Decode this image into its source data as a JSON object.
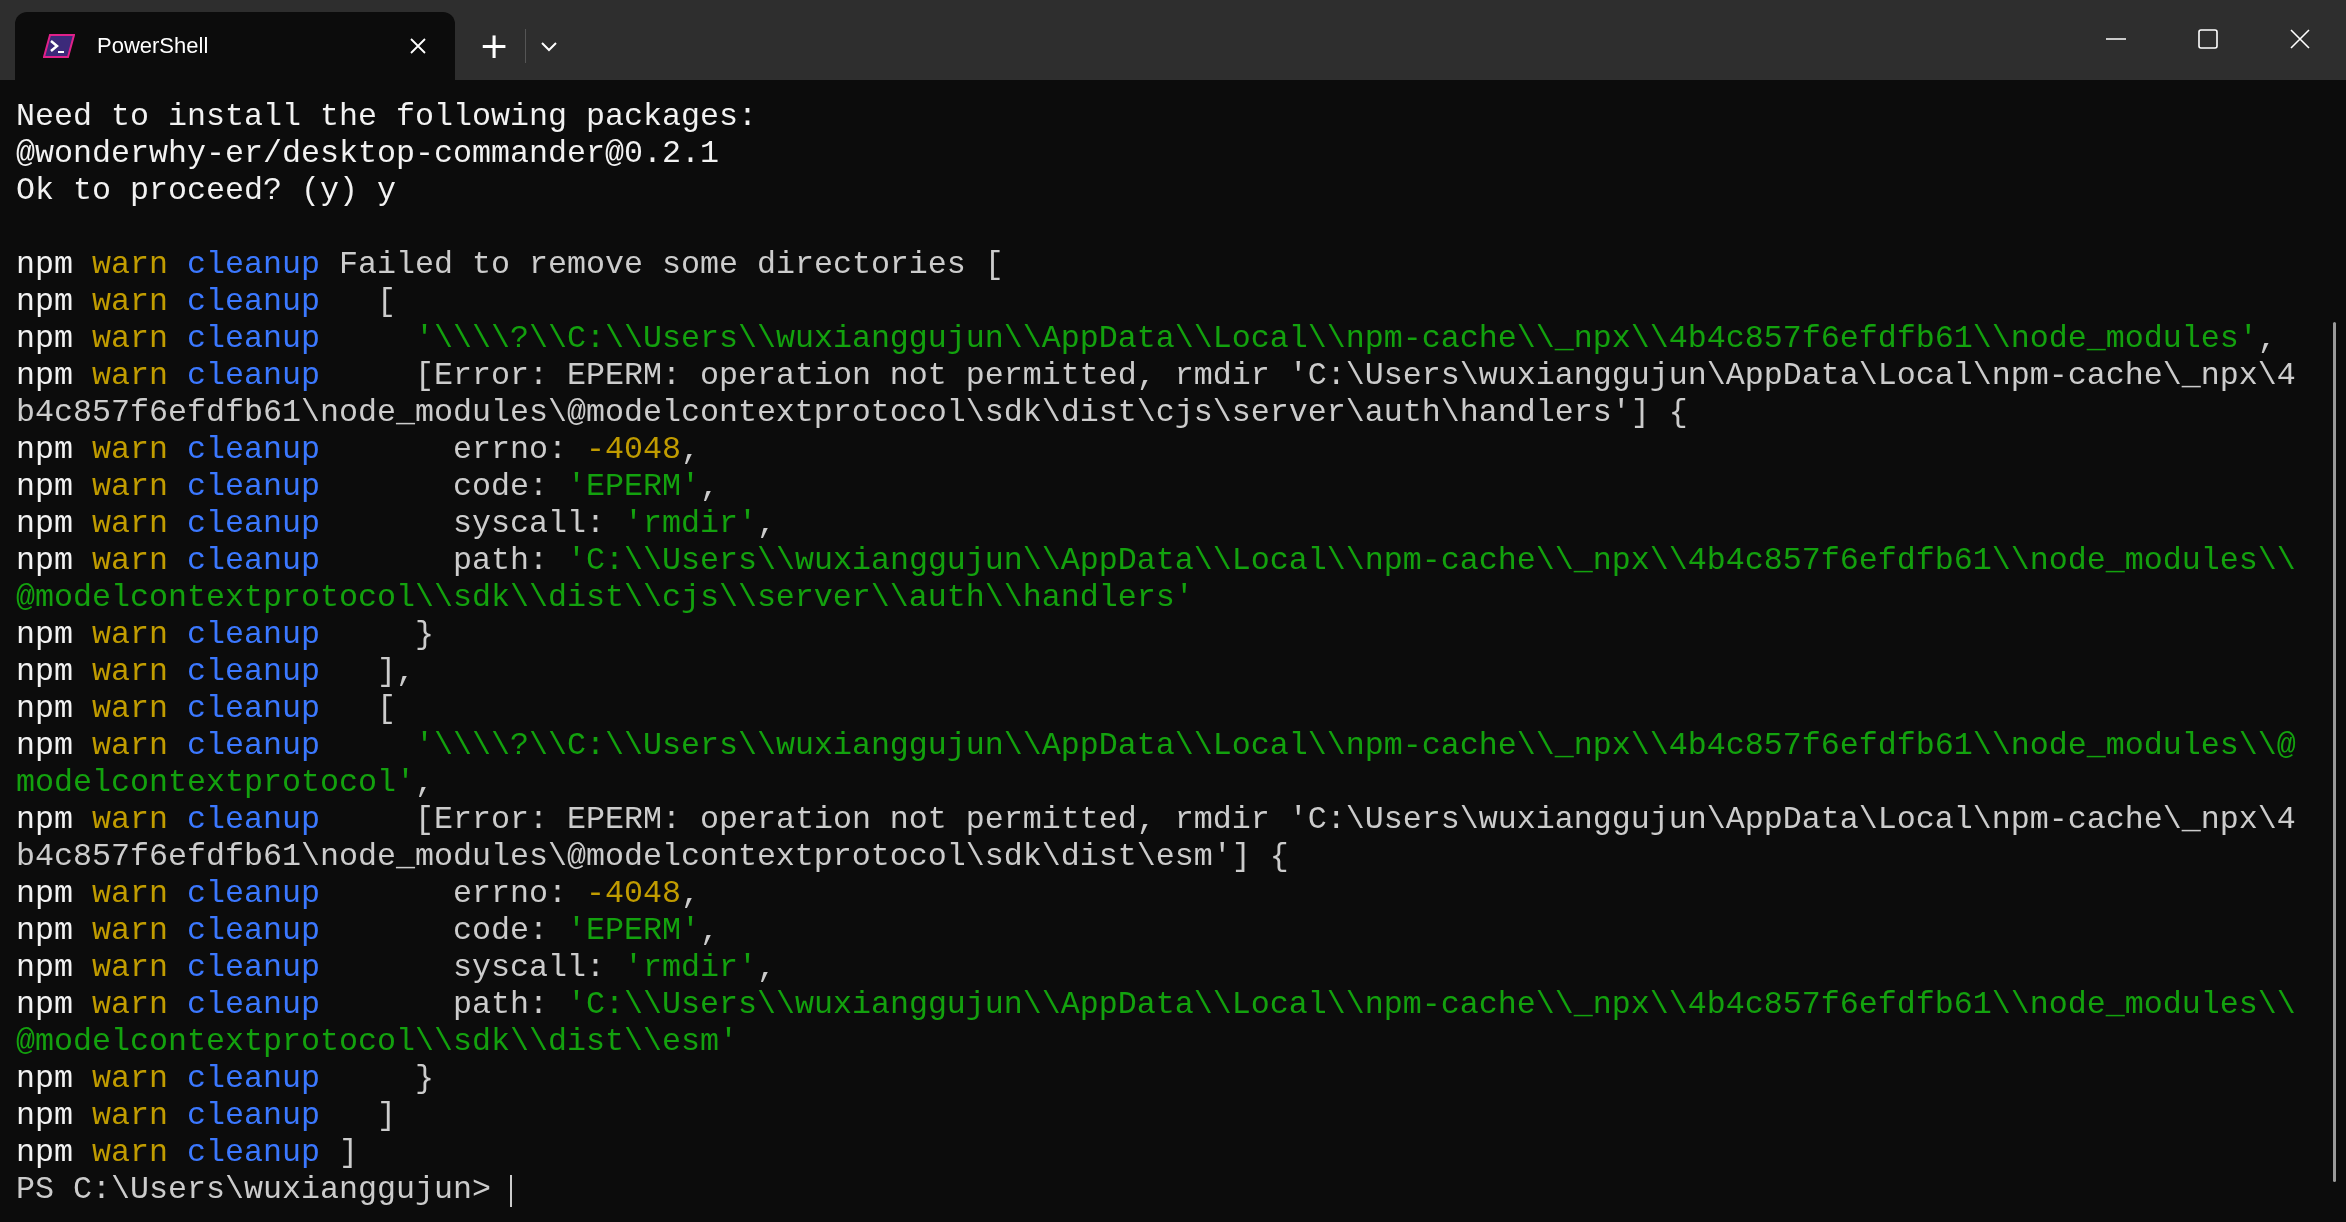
{
  "window": {
    "tabs": [
      {
        "title": "PowerShell",
        "selected": true
      }
    ],
    "new_tab": "+"
  },
  "terminal": {
    "blocks": [
      {
        "lines": [
          [
            {
              "kind": "bright",
              "text": "Need to install the following packages:"
            }
          ],
          [
            {
              "kind": "bright",
              "text": "@wonderwhy-er/desktop-commander@0.2.1"
            }
          ],
          [
            {
              "kind": "bright",
              "text": "Ok to proceed? (y) y"
            }
          ]
        ]
      },
      {
        "lines": [
          [
            {
              "kind": "bright",
              "text": "npm"
            },
            {
              "kind": "warn",
              "text": " warn"
            },
            {
              "kind": "cleanup",
              "text": " cleanup"
            },
            {
              "kind": "plain",
              "text": " Failed to remove some directories ["
            }
          ],
          [
            {
              "kind": "bright",
              "text": "npm"
            },
            {
              "kind": "warn",
              "text": " warn"
            },
            {
              "kind": "cleanup",
              "text": " cleanup"
            },
            {
              "kind": "plain",
              "text": "   ["
            }
          ],
          [
            {
              "kind": "bright",
              "text": "npm"
            },
            {
              "kind": "warn",
              "text": " warn"
            },
            {
              "kind": "cleanup",
              "text": " cleanup"
            },
            {
              "kind": "string",
              "text": "     '\\\\\\\\?\\\\C:\\\\Users\\\\wuxianggujun\\\\AppData\\\\Local\\\\npm-cache\\\\_npx\\\\4b4c857f6efdfb61\\\\node_modules'"
            },
            {
              "kind": "plain",
              "text": ","
            }
          ],
          [
            {
              "kind": "bright",
              "text": "npm"
            },
            {
              "kind": "warn",
              "text": " warn"
            },
            {
              "kind": "cleanup",
              "text": " cleanup"
            },
            {
              "kind": "plain",
              "text": "     [Error: EPERM: operation not permitted, rmdir 'C:\\Users\\wuxianggujun\\AppData\\Local\\npm-cache\\_npx\\4"
            }
          ],
          [
            {
              "kind": "plain",
              "text": "b4c857f6efdfb61\\node_modules\\@modelcontextprotocol\\sdk\\dist\\cjs\\server\\auth\\handlers'] {"
            }
          ],
          [
            {
              "kind": "bright",
              "text": "npm"
            },
            {
              "kind": "warn",
              "text": " warn"
            },
            {
              "kind": "cleanup",
              "text": " cleanup"
            },
            {
              "kind": "plain",
              "text": "       errno: "
            },
            {
              "kind": "number",
              "text": "-4048"
            },
            {
              "kind": "plain",
              "text": ","
            }
          ],
          [
            {
              "kind": "bright",
              "text": "npm"
            },
            {
              "kind": "warn",
              "text": " warn"
            },
            {
              "kind": "cleanup",
              "text": " cleanup"
            },
            {
              "kind": "plain",
              "text": "       code: "
            },
            {
              "kind": "string",
              "text": "'EPERM'"
            },
            {
              "kind": "plain",
              "text": ","
            }
          ],
          [
            {
              "kind": "bright",
              "text": "npm"
            },
            {
              "kind": "warn",
              "text": " warn"
            },
            {
              "kind": "cleanup",
              "text": " cleanup"
            },
            {
              "kind": "plain",
              "text": "       syscall: "
            },
            {
              "kind": "string",
              "text": "'rmdir'"
            },
            {
              "kind": "plain",
              "text": ","
            }
          ],
          [
            {
              "kind": "bright",
              "text": "npm"
            },
            {
              "kind": "warn",
              "text": " warn"
            },
            {
              "kind": "cleanup",
              "text": " cleanup"
            },
            {
              "kind": "plain",
              "text": "       path: "
            },
            {
              "kind": "string",
              "text": "'C:\\\\Users\\\\wuxianggujun\\\\AppData\\\\Local\\\\npm-cache\\\\_npx\\\\4b4c857f6efdfb61\\\\node_modules\\\\"
            }
          ],
          [
            {
              "kind": "string",
              "text": "@modelcontextprotocol\\\\sdk\\\\dist\\\\cjs\\\\server\\\\auth\\\\handlers'"
            }
          ],
          [
            {
              "kind": "bright",
              "text": "npm"
            },
            {
              "kind": "warn",
              "text": " warn"
            },
            {
              "kind": "cleanup",
              "text": " cleanup"
            },
            {
              "kind": "plain",
              "text": "     }"
            }
          ],
          [
            {
              "kind": "bright",
              "text": "npm"
            },
            {
              "kind": "warn",
              "text": " warn"
            },
            {
              "kind": "cleanup",
              "text": " cleanup"
            },
            {
              "kind": "plain",
              "text": "   ],"
            }
          ],
          [
            {
              "kind": "bright",
              "text": "npm"
            },
            {
              "kind": "warn",
              "text": " warn"
            },
            {
              "kind": "cleanup",
              "text": " cleanup"
            },
            {
              "kind": "plain",
              "text": "   ["
            }
          ],
          [
            {
              "kind": "bright",
              "text": "npm"
            },
            {
              "kind": "warn",
              "text": " warn"
            },
            {
              "kind": "cleanup",
              "text": " cleanup"
            },
            {
              "kind": "string",
              "text": "     '\\\\\\\\?\\\\C:\\\\Users\\\\wuxianggujun\\\\AppData\\\\Local\\\\npm-cache\\\\_npx\\\\4b4c857f6efdfb61\\\\node_modules\\\\@"
            }
          ],
          [
            {
              "kind": "string",
              "text": "modelcontextprotocol'"
            },
            {
              "kind": "plain",
              "text": ","
            }
          ],
          [
            {
              "kind": "bright",
              "text": "npm"
            },
            {
              "kind": "warn",
              "text": " warn"
            },
            {
              "kind": "cleanup",
              "text": " cleanup"
            },
            {
              "kind": "plain",
              "text": "     [Error: EPERM: operation not permitted, rmdir 'C:\\Users\\wuxianggujun\\AppData\\Local\\npm-cache\\_npx\\4"
            }
          ],
          [
            {
              "kind": "plain",
              "text": "b4c857f6efdfb61\\node_modules\\@modelcontextprotocol\\sdk\\dist\\esm'] {"
            }
          ],
          [
            {
              "kind": "bright",
              "text": "npm"
            },
            {
              "kind": "warn",
              "text": " warn"
            },
            {
              "kind": "cleanup",
              "text": " cleanup"
            },
            {
              "kind": "plain",
              "text": "       errno: "
            },
            {
              "kind": "number",
              "text": "-4048"
            },
            {
              "kind": "plain",
              "text": ","
            }
          ],
          [
            {
              "kind": "bright",
              "text": "npm"
            },
            {
              "kind": "warn",
              "text": " warn"
            },
            {
              "kind": "cleanup",
              "text": " cleanup"
            },
            {
              "kind": "plain",
              "text": "       code: "
            },
            {
              "kind": "string",
              "text": "'EPERM'"
            },
            {
              "kind": "plain",
              "text": ","
            }
          ],
          [
            {
              "kind": "bright",
              "text": "npm"
            },
            {
              "kind": "warn",
              "text": " warn"
            },
            {
              "kind": "cleanup",
              "text": " cleanup"
            },
            {
              "kind": "plain",
              "text": "       syscall: "
            },
            {
              "kind": "string",
              "text": "'rmdir'"
            },
            {
              "kind": "plain",
              "text": ","
            }
          ],
          [
            {
              "kind": "bright",
              "text": "npm"
            },
            {
              "kind": "warn",
              "text": " warn"
            },
            {
              "kind": "cleanup",
              "text": " cleanup"
            },
            {
              "kind": "plain",
              "text": "       path: "
            },
            {
              "kind": "string",
              "text": "'C:\\\\Users\\\\wuxianggujun\\\\AppData\\\\Local\\\\npm-cache\\\\_npx\\\\4b4c857f6efdfb61\\\\node_modules\\\\"
            }
          ],
          [
            {
              "kind": "string",
              "text": "@modelcontextprotocol\\\\sdk\\\\dist\\\\esm'"
            }
          ],
          [
            {
              "kind": "bright",
              "text": "npm"
            },
            {
              "kind": "warn",
              "text": " warn"
            },
            {
              "kind": "cleanup",
              "text": " cleanup"
            },
            {
              "kind": "plain",
              "text": "     }"
            }
          ],
          [
            {
              "kind": "bright",
              "text": "npm"
            },
            {
              "kind": "warn",
              "text": " warn"
            },
            {
              "kind": "cleanup",
              "text": " cleanup"
            },
            {
              "kind": "plain",
              "text": "   ]"
            }
          ],
          [
            {
              "kind": "bright",
              "text": "npm"
            },
            {
              "kind": "warn",
              "text": " warn"
            },
            {
              "kind": "cleanup",
              "text": " cleanup"
            },
            {
              "kind": "plain",
              "text": " ]"
            }
          ]
        ]
      }
    ],
    "prompt": {
      "text": "PS C:\\Users\\wuxianggujun> ",
      "cursor": true
    }
  }
}
